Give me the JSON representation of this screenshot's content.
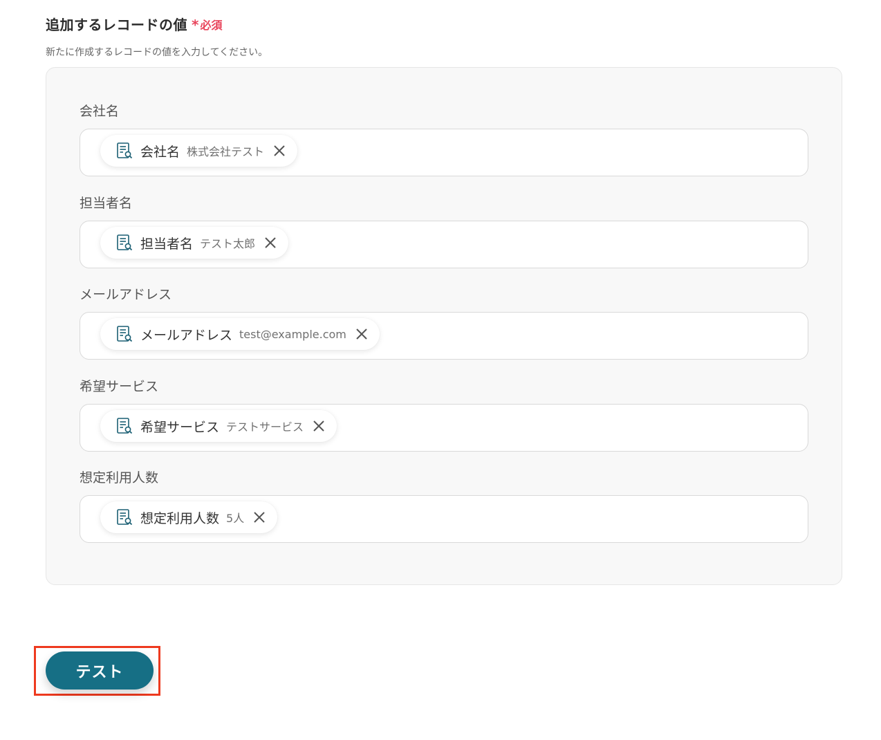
{
  "section": {
    "title": "追加するレコードの値",
    "required_asterisk": "*",
    "required_label": "必須",
    "description": "新たに作成するレコードの値を入力してください。"
  },
  "fields": [
    {
      "label": "会社名",
      "chip_name": "会社名",
      "chip_value": "株式会社テスト"
    },
    {
      "label": "担当者名",
      "chip_name": "担当者名",
      "chip_value": "テスト太郎"
    },
    {
      "label": "メールアドレス",
      "chip_name": "メールアドレス",
      "chip_value": "test@example.com"
    },
    {
      "label": "希望サービス",
      "chip_name": "希望サービス",
      "chip_value": "テストサービス"
    },
    {
      "label": "想定利用人数",
      "chip_name": "想定利用人数",
      "chip_value": "5人"
    }
  ],
  "actions": {
    "test_label": "テスト"
  },
  "icons": {
    "chip_icon": "document-search-icon",
    "remove_icon": "close-icon"
  },
  "colors": {
    "accent": "#166f85",
    "required": "#e8455c",
    "highlight": "#ee3a1f",
    "icon": "#1a5f73"
  }
}
